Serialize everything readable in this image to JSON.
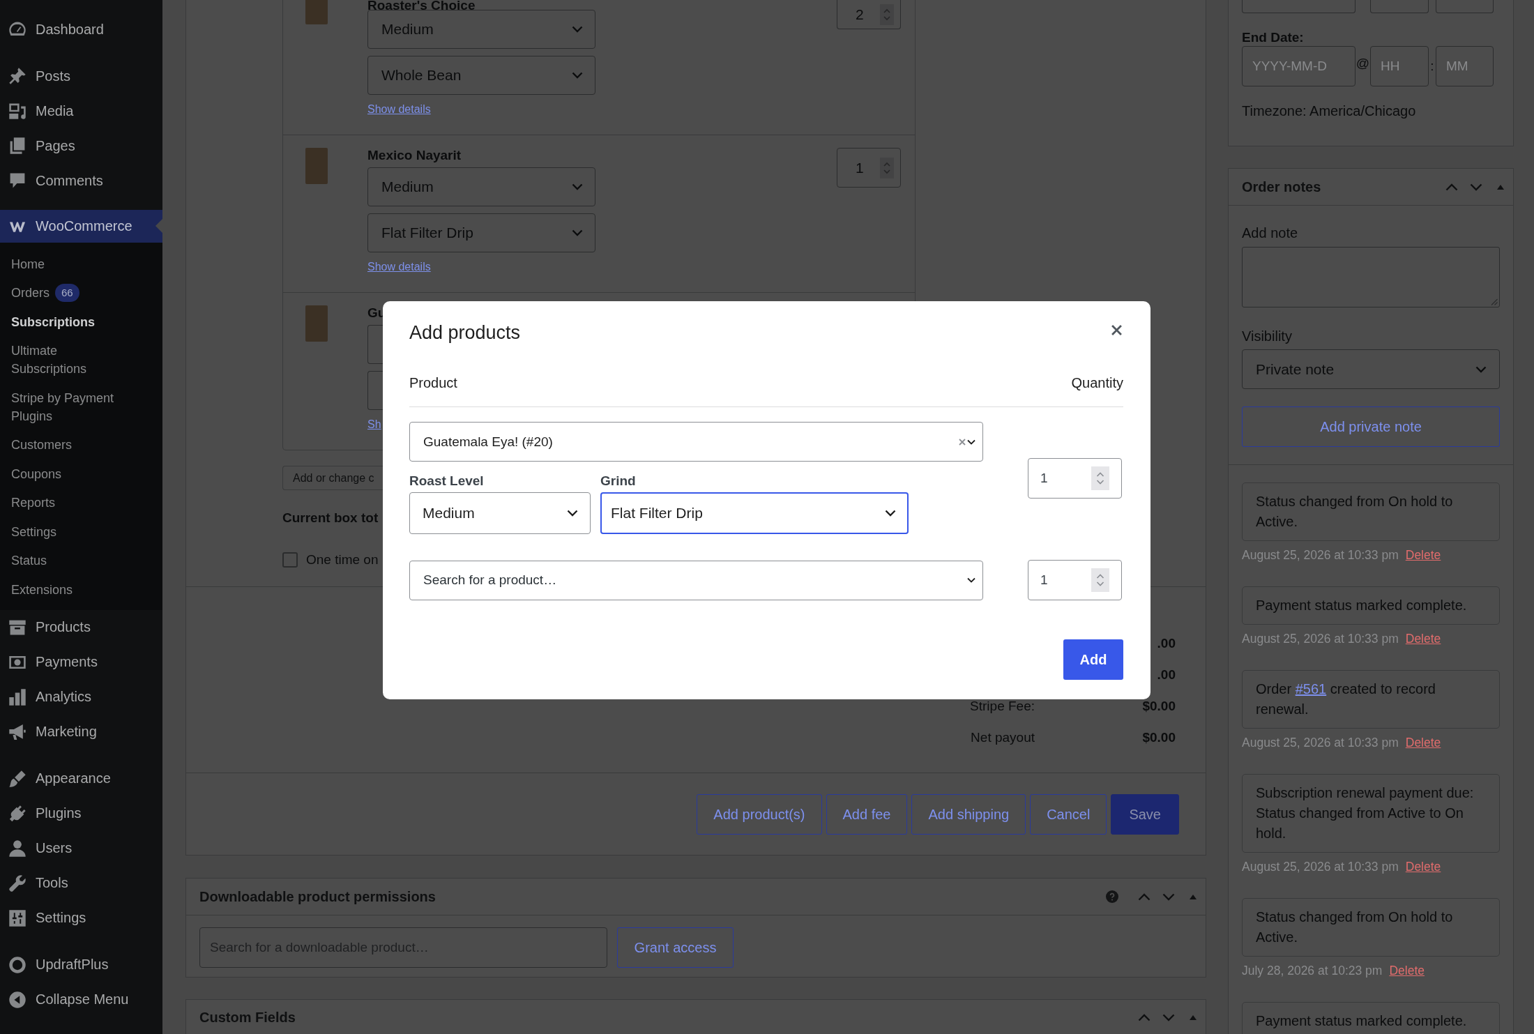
{
  "sidebar": {
    "groups": [
      {
        "items": [
          {
            "label": "Dashboard",
            "selected": false
          }
        ]
      },
      {
        "items": [
          {
            "label": "Posts",
            "selected": false
          },
          {
            "label": "Media",
            "selected": false
          },
          {
            "label": "Pages",
            "selected": false
          },
          {
            "label": "Comments",
            "selected": false
          }
        ]
      },
      {
        "items": [
          {
            "label": "WooCommerce",
            "selected": true,
            "children": [
              {
                "label": "Home",
                "selected": false
              },
              {
                "label": "Orders",
                "badge": "66",
                "selected": false
              },
              {
                "label": "Subscriptions",
                "selected": true
              },
              {
                "label": "Ultimate Subscriptions",
                "selected": false
              },
              {
                "label": "Stripe by Payment Plugins",
                "selected": false
              },
              {
                "label": "Customers",
                "selected": false
              },
              {
                "label": "Coupons",
                "selected": false
              },
              {
                "label": "Reports",
                "selected": false
              },
              {
                "label": "Settings",
                "selected": false
              },
              {
                "label": "Status",
                "selected": false
              },
              {
                "label": "Extensions",
                "selected": false
              }
            ]
          },
          {
            "label": "Products",
            "selected": false
          },
          {
            "label": "Payments",
            "selected": false
          },
          {
            "label": "Analytics",
            "selected": false
          },
          {
            "label": "Marketing",
            "selected": false
          }
        ]
      },
      {
        "items": [
          {
            "label": "Appearance",
            "selected": false
          },
          {
            "label": "Plugins",
            "selected": false
          },
          {
            "label": "Users",
            "selected": false
          },
          {
            "label": "Tools",
            "selected": false
          },
          {
            "label": "Settings",
            "selected": false
          }
        ]
      },
      {
        "items": [
          {
            "label": "UpdraftPlus",
            "selected": false
          }
        ]
      }
    ],
    "collapse": "Collapse Menu"
  },
  "order_items": {
    "items": [
      {
        "name": "Roaster's Choice",
        "options": [
          {
            "kind": "select",
            "value": "Medium"
          },
          {
            "kind": "select",
            "value": "Whole Bean"
          }
        ],
        "link": "Show details",
        "quantity": "2"
      },
      {
        "name": "Mexico Nayarit",
        "options": [
          {
            "kind": "select",
            "value": "Medium"
          },
          {
            "kind": "select",
            "value": "Flat Filter Drip"
          }
        ],
        "link": "Show details",
        "quantity": "1"
      },
      {
        "name": "Gu",
        "options": [
          {
            "kind": "covered"
          },
          {
            "kind": "covered"
          }
        ],
        "link": "Sh"
      }
    ],
    "change_button": "Add or change c",
    "box_total": "Current box tot",
    "one_time": {
      "label": "One time on",
      "checked": false
    }
  },
  "totals": [
    {
      "value": ".00"
    },
    {
      "value": ".00"
    },
    {
      "label": "Stripe Fee:",
      "value": "$0.00"
    },
    {
      "label": "Net payout",
      "value": "$0.00"
    }
  ],
  "actions": [
    {
      "label": "Add product(s)",
      "kind": "secondary"
    },
    {
      "label": "Add fee",
      "kind": "secondary"
    },
    {
      "label": "Add shipping",
      "kind": "secondary"
    },
    {
      "label": "Cancel",
      "kind": "secondary"
    },
    {
      "label": "Save",
      "kind": "primary"
    }
  ],
  "downloads": {
    "title": "Downloadable product permissions",
    "search": {
      "placeholder": "Search for a downloadable product…"
    },
    "button": "Grant access"
  },
  "custom_fields": {
    "title": "Custom Fields"
  },
  "schedule": {
    "end_date": {
      "label": "End Date:",
      "date": {
        "placeholder": "YYYY-MM-D"
      },
      "at": "@",
      "hour": {
        "placeholder": "HH"
      },
      "colon": ":",
      "minute": {
        "placeholder": "MM"
      }
    },
    "timezone": "Timezone: America/Chicago"
  },
  "order_notes": {
    "title": "Order notes",
    "add_note": {
      "label": "Add note"
    },
    "visibility": {
      "label": "Visibility",
      "value": "Private note"
    },
    "button": "Add private note",
    "notes": [
      {
        "parts": [
          {
            "kind": "text",
            "text": "Status changed from On hold to Active."
          }
        ],
        "date": "August 25, 2026 at 10:33 pm",
        "delete": "Delete"
      },
      {
        "parts": [
          {
            "kind": "text",
            "text": "Payment status marked complete."
          }
        ],
        "date": "August 25, 2026 at 10:33 pm",
        "delete": "Delete"
      },
      {
        "parts": [
          {
            "kind": "text",
            "text": "Order "
          },
          {
            "kind": "link",
            "text": "#561"
          },
          {
            "kind": "text",
            "text": " created to record renewal."
          }
        ],
        "date": "August 25, 2026 at 10:33 pm",
        "delete": "Delete"
      },
      {
        "parts": [
          {
            "kind": "text",
            "text": "Subscription renewal payment due: Status changed from Active to On hold."
          }
        ],
        "date": "August 25, 2026 at 10:33 pm",
        "delete": "Delete"
      },
      {
        "parts": [
          {
            "kind": "text",
            "text": "Status changed from On hold to Active."
          }
        ],
        "date": "July 28, 2026 at 10:23 pm",
        "delete": "Delete"
      },
      {
        "parts": [
          {
            "kind": "text",
            "text": "Payment status marked complete."
          }
        ]
      }
    ]
  },
  "modal": {
    "title": "Add products",
    "columns": {
      "product": "Product",
      "quantity": "Quantity"
    },
    "rows": [
      {
        "kind": "chosen",
        "product": "Guatemala Eya! (#20)",
        "attributes": [
          {
            "label": "Roast Level",
            "value": "Medium",
            "focused": false
          },
          {
            "label": "Grind",
            "value": "Flat Filter Drip",
            "focused": true
          }
        ],
        "quantity": "1"
      },
      {
        "kind": "search",
        "placeholder": "Search for a product…",
        "quantity": "1"
      }
    ],
    "button": "Add"
  }
}
